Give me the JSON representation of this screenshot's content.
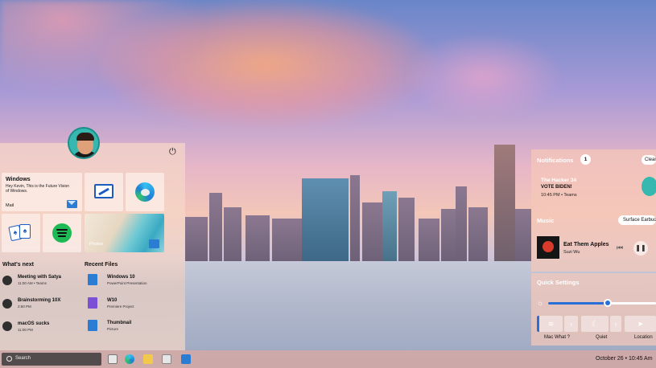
{
  "start_menu": {
    "mail_tile": {
      "title": "Windows",
      "body": "Hey Kevin, This is the Future Vision of Windows.",
      "label": "Mail"
    },
    "photos_label": "Photos",
    "whats_next_title": "What's next",
    "recent_files_title": "Recent Files",
    "whats_next": [
      {
        "title": "Meeting with Satya",
        "sub": "11:00 AM • Teams",
        "icon": "people-icon"
      },
      {
        "title": "Brainstorming 10X",
        "sub": "2:50 PM",
        "icon": "lightbulb-icon"
      },
      {
        "title": "macOS sucks",
        "sub": "11:00 PM",
        "icon": "trash-icon"
      }
    ],
    "recent_files": [
      {
        "title": "Windows 10",
        "sub": "PowerPoint Presentation",
        "color": "#2b7cd3"
      },
      {
        "title": "W10",
        "sub": "Premiere Project",
        "color": "#7b4fd6"
      },
      {
        "title": "Thumbnail",
        "sub": "Picture",
        "color": "#2b7cd3"
      }
    ]
  },
  "taskbar": {
    "search_placeholder": "Search",
    "datetime": "October 26 • 10:45 Am"
  },
  "notifications": {
    "title": "Notifications",
    "count": "1",
    "clear_label": "Clear",
    "item": {
      "sender": "The Hacker 34",
      "message": "VOTE BIDEN!",
      "meta": "10:45 PM • Teams"
    }
  },
  "music": {
    "title": "Music",
    "device": "Surface Earbuds",
    "song": "Eat Them Apples",
    "artist": "Suzi Wu"
  },
  "quick_settings": {
    "title": "Quick Settings",
    "brightness": 0.55,
    "labels": [
      "Mac What ?",
      "Quiet",
      "Location"
    ]
  },
  "colors": {
    "accent": "#2a6fd6",
    "panel": "#f5c8b9"
  }
}
